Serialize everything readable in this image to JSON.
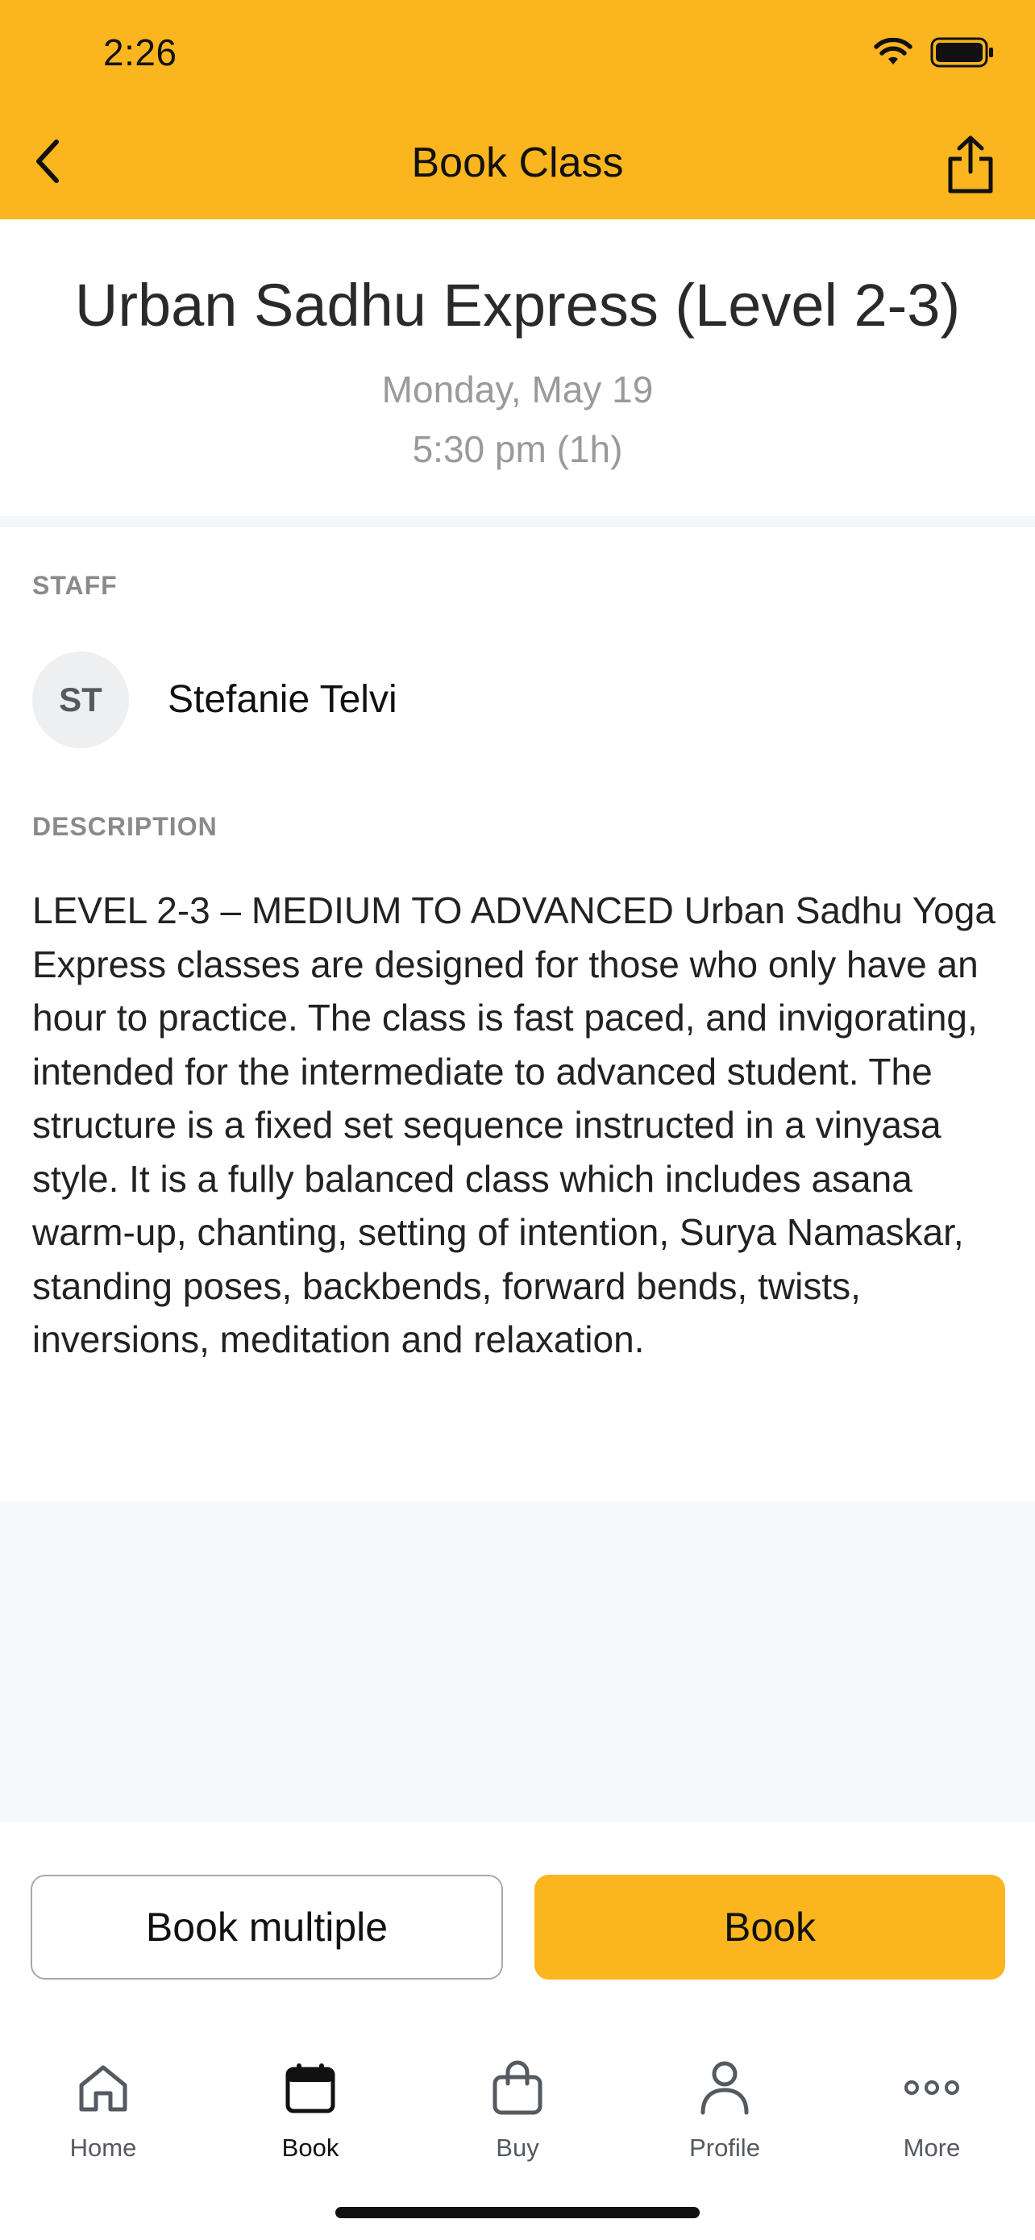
{
  "status_bar": {
    "time": "2:26",
    "wifi_icon": "wifi-icon",
    "battery_icon": "battery-icon"
  },
  "nav": {
    "title": "Book Class",
    "back_icon": "chevron-left-icon",
    "share_icon": "share-icon"
  },
  "class": {
    "title": "Urban Sadhu Express (Level 2-3)",
    "date": "Monday, May 19",
    "time": "5:30 pm (1h)"
  },
  "staff": {
    "label": "STAFF",
    "initials": "ST",
    "name": "Stefanie Telvi"
  },
  "description": {
    "label": "DESCRIPTION",
    "text": "LEVEL 2-3 – MEDIUM TO ADVANCED Urban Sadhu Yoga Express classes are designed for those who only have an hour to practice. The class is fast paced, and invigorating, intended for the intermediate to advanced student. The structure is a fixed set sequence instructed in a vinyasa style. It is a fully balanced class which includes asana warm-up, chanting, setting of intention, Surya Namaskar, standing poses, backbends, forward bends, twists, inversions, meditation and relaxation."
  },
  "actions": {
    "book_multiple": "Book multiple",
    "book": "Book"
  },
  "tabs": [
    {
      "label": "Home",
      "icon": "home-icon",
      "active": false
    },
    {
      "label": "Book",
      "icon": "calendar-icon",
      "active": true
    },
    {
      "label": "Buy",
      "icon": "shopping-bag-icon",
      "active": false
    },
    {
      "label": "Profile",
      "icon": "person-icon",
      "active": false
    },
    {
      "label": "More",
      "icon": "more-dots-icon",
      "active": false
    }
  ],
  "colors": {
    "accent": "#FBB51E",
    "text_primary": "#222222",
    "text_secondary": "#9a9a9a",
    "label_grey": "#8a8a8a"
  }
}
